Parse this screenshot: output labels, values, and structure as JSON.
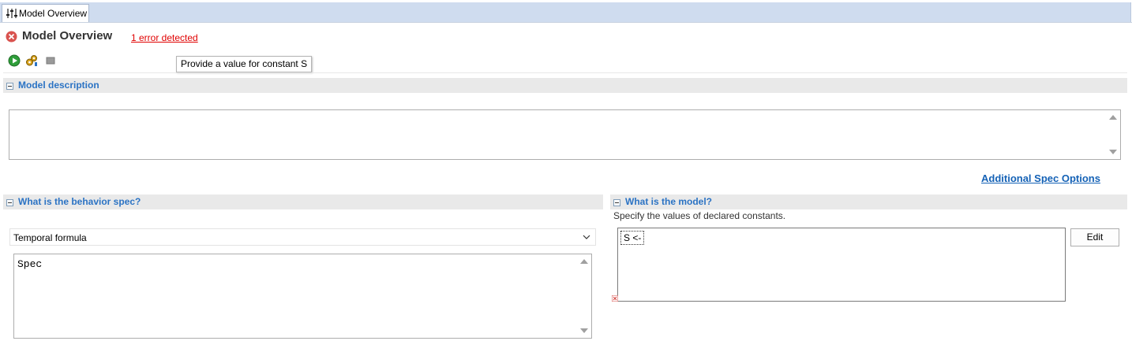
{
  "tab": {
    "label": "Model Overview",
    "icon": "sliders-icon"
  },
  "header": {
    "title": "Model Overview",
    "status_icon": "error-icon",
    "error_link": "1 error detected"
  },
  "toolbar": {
    "buttons": [
      {
        "icon": "run-icon"
      },
      {
        "icon": "gears-icon"
      },
      {
        "icon": "stop-icon"
      }
    ],
    "tooltip": "Provide a value for constant S"
  },
  "model_description": {
    "title": "Model description",
    "text": ""
  },
  "additional_spec_options": "Additional Spec Options",
  "behavior_spec": {
    "title": "What is the behavior spec?",
    "selected_option": "Temporal formula",
    "formula": "Spec"
  },
  "model": {
    "title": "What is the model?",
    "description": "Specify the values of declared constants.",
    "constants": [
      "S <-"
    ],
    "edit_label": "Edit"
  },
  "colors": {
    "section_title": "#2b73c4",
    "error": "#e00000",
    "tab_band": "#cfdcef"
  }
}
